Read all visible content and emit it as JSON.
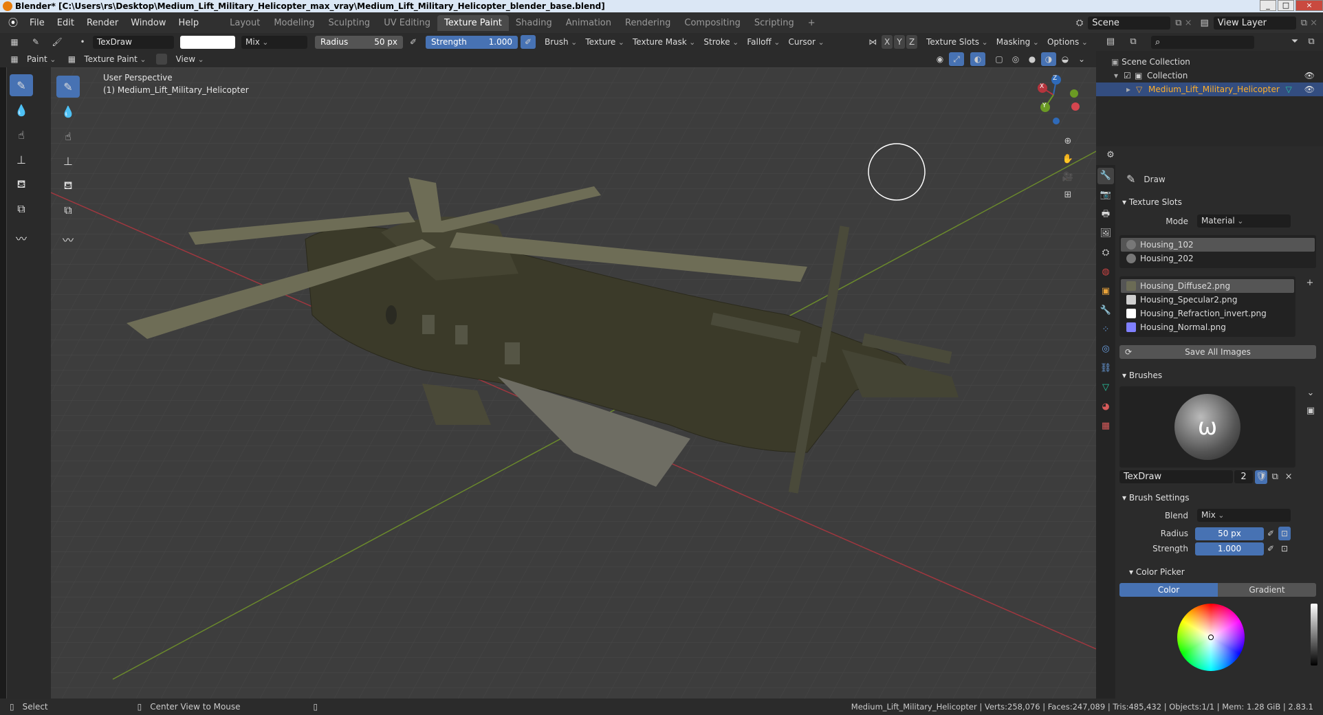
{
  "window": {
    "title": "Blender* [C:\\Users\\rs\\Desktop\\Medium_Lift_Military_Helicopter_max_vray\\Medium_Lift_Military_Helicopter_blender_base.blend]",
    "min": "_",
    "max": "□",
    "close": "×"
  },
  "menus": [
    "File",
    "Edit",
    "Render",
    "Window",
    "Help"
  ],
  "workspaces": [
    "Layout",
    "Modeling",
    "Sculpting",
    "UV Editing",
    "Texture Paint",
    "Shading",
    "Animation",
    "Rendering",
    "Compositing",
    "Scripting"
  ],
  "workspace_add": "+",
  "scene": "Scene",
  "view_layer": "View Layer",
  "toolheader": {
    "brush_name": "TexDraw",
    "blend": "Mix",
    "radius_label": "Radius",
    "radius_value": "50 px",
    "strength_label": "Strength",
    "strength_value": "1.000",
    "menus": [
      "Brush",
      "Texture",
      "Texture Mask",
      "Stroke",
      "Falloff",
      "Cursor"
    ],
    "axes": [
      "X",
      "Y",
      "Z"
    ],
    "right_menus": [
      "Texture Slots",
      "Masking",
      "Options"
    ]
  },
  "modeheader": {
    "mode_short": "Paint",
    "mode": "Texture Paint",
    "view": "View"
  },
  "viewport": {
    "perspective": "User Perspective",
    "object_label": "(1) Medium_Lift_Military_Helicopter",
    "gizmo": {
      "x": "X",
      "y": "Y",
      "z": "Z"
    }
  },
  "outliner": {
    "scene_collection": "Scene Collection",
    "collection": "Collection",
    "object": "Medium_Lift_Military_Helicopter"
  },
  "properties": {
    "active_tool": "Draw",
    "texture_slots_title": "Texture Slots",
    "mode_label": "Mode",
    "mode_value": "Material",
    "materials": [
      "Housing_102",
      "Housing_202"
    ],
    "images": [
      {
        "name": "Housing_Diffuse2.png",
        "color": "#6b6b55"
      },
      {
        "name": "Housing_Specular2.png",
        "color": "#cfcfcf"
      },
      {
        "name": "Housing_Refraction_invert.png",
        "color": "#ffffff"
      },
      {
        "name": "Housing_Normal.png",
        "color": "#8080ff"
      }
    ],
    "save_all": "Save All Images",
    "brushes_title": "Brushes",
    "brush_name": "TexDraw",
    "brush_users": "2",
    "brush_settings_title": "Brush Settings",
    "blend_label": "Blend",
    "blend_value": "Mix",
    "radius_label": "Radius",
    "radius_value": "50 px",
    "strength_label": "Strength",
    "strength_value": "1.000",
    "color_picker_title": "Color Picker",
    "color_tab": "Color",
    "gradient_tab": "Gradient"
  },
  "status": {
    "select": "Select",
    "center_view": "Center View to Mouse",
    "stats": "Medium_Lift_Military_Helicopter | Verts:258,076 | Faces:247,089 | Tris:485,432 | Objects:1/1 | Mem: 1.28 GiB | 2.83.1"
  }
}
